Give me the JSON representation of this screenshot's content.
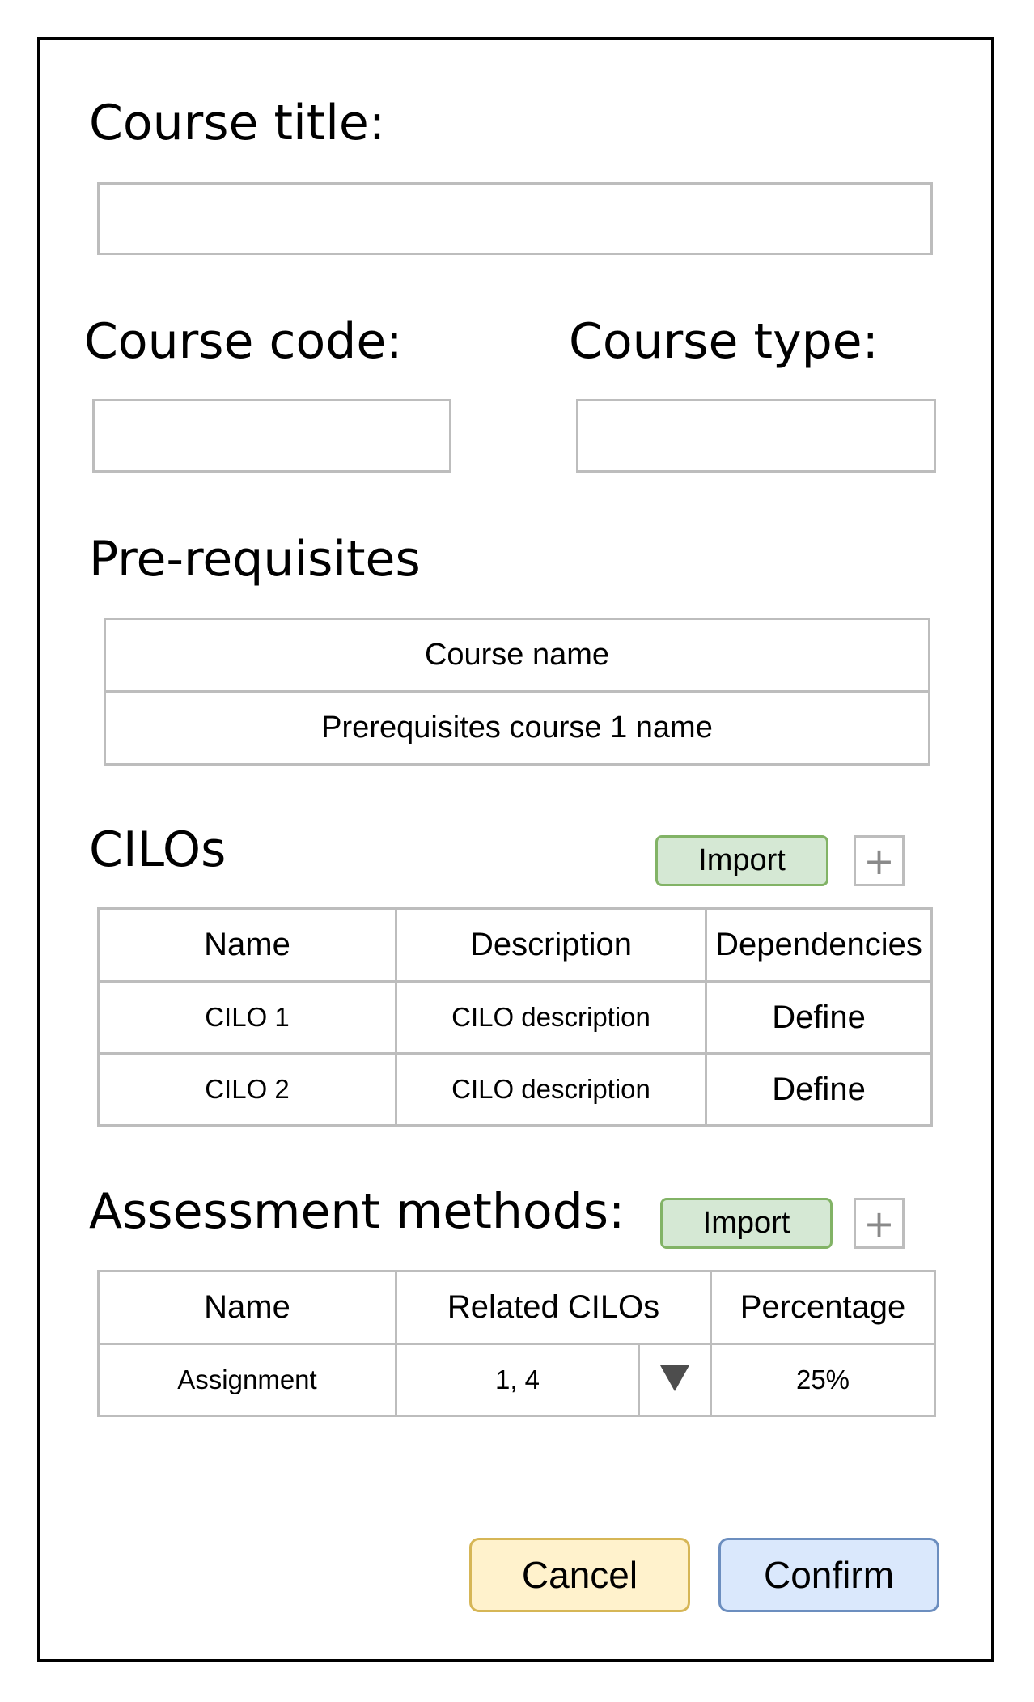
{
  "form": {
    "course_title_label": "Course title:",
    "course_title_value": "",
    "course_code_label": "Course code:",
    "course_code_value": "",
    "course_type_label": "Course type:",
    "course_type_value": ""
  },
  "prerequisites": {
    "heading": "Pre-requisites",
    "column_header": "Course name",
    "rows": [
      "Prerequisites course 1 name"
    ]
  },
  "cilos": {
    "heading": "CILOs",
    "import_label": "Import",
    "add_icon": "plus-icon",
    "headers": [
      "Name",
      "Description",
      "Dependencies"
    ],
    "rows": [
      {
        "name": "CILO 1",
        "description": "CILO description",
        "dependencies": "Define"
      },
      {
        "name": "CILO 2",
        "description": "CILO description",
        "dependencies": "Define"
      }
    ]
  },
  "assessment": {
    "heading": "Assessment methods:",
    "import_label": "Import",
    "add_icon": "plus-icon",
    "headers": [
      "Name",
      "Related CILOs",
      "Percentage"
    ],
    "rows": [
      {
        "name": "Assignment",
        "related_cilos": "1, 4",
        "percentage": "25%"
      }
    ]
  },
  "actions": {
    "cancel_label": "Cancel",
    "confirm_label": "Confirm"
  },
  "colors": {
    "import_fill": "#d5e8d4",
    "import_border": "#82b366",
    "cancel_fill": "#fff2cc",
    "cancel_border": "#d6b656",
    "confirm_fill": "#dae8fc",
    "confirm_border": "#6c8ebf"
  }
}
